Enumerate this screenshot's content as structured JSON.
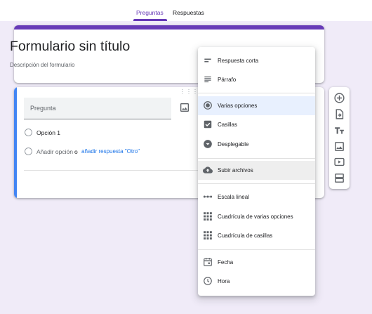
{
  "tabs": [
    {
      "label": "Preguntas",
      "active": true
    },
    {
      "label": "Respuestas",
      "active": false
    }
  ],
  "form": {
    "title": "Formulario sin título",
    "description_placeholder": "Descripción del formulario"
  },
  "question": {
    "placeholder": "Pregunta",
    "drag_handle": "⠿",
    "options": [
      {
        "label": "Opción 1"
      }
    ],
    "add_option_label": "Añadir opción",
    "add_option_connector": "o",
    "add_other_link": "añadir respuesta \"Otro\""
  },
  "type_menu": {
    "items": [
      {
        "label": "Respuesta corta",
        "icon": "short-text-icon"
      },
      {
        "label": "Párrafo",
        "icon": "paragraph-icon"
      },
      {
        "label": "Varias opciones",
        "icon": "radio-button-icon",
        "selected": true
      },
      {
        "label": "Casillas",
        "icon": "checkbox-icon"
      },
      {
        "label": "Desplegable",
        "icon": "dropdown-icon"
      },
      {
        "label": "Subir archivos",
        "icon": "cloud-upload-icon",
        "hovered": true
      },
      {
        "label": "Escala lineal",
        "icon": "linear-scale-icon"
      },
      {
        "label": "Cuadrícula de varias opciones",
        "icon": "grid-icon"
      },
      {
        "label": "Cuadrícula de casillas",
        "icon": "grid-icon"
      },
      {
        "label": "Fecha",
        "icon": "calendar-icon"
      },
      {
        "label": "Hora",
        "icon": "clock-icon"
      }
    ]
  },
  "side_toolbar": {
    "buttons": [
      "add-question-icon",
      "import-questions-icon",
      "add-title-icon",
      "add-image-icon",
      "add-video-icon",
      "add-section-icon"
    ]
  },
  "colors": {
    "accent": "#673ab7",
    "background": "#f0ebf8",
    "question_bar": "#4285f4",
    "link": "#1a73e8",
    "selected_item": "#e8f0fe"
  }
}
